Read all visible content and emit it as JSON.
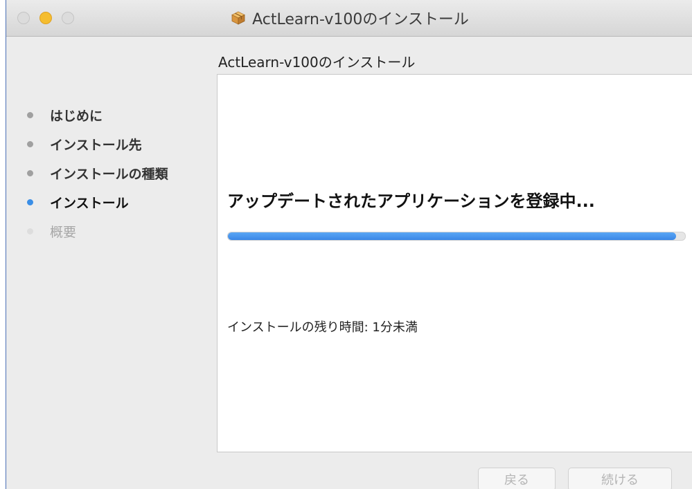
{
  "window": {
    "title": "ActLearn-v100のインストール",
    "app_icon": "package-icon"
  },
  "header": {
    "subtitle": "ActLearn-v100のインストール"
  },
  "sidebar": {
    "steps": [
      {
        "label": "はじめに",
        "state": "done"
      },
      {
        "label": "インストール先",
        "state": "done"
      },
      {
        "label": "インストールの種類",
        "state": "done"
      },
      {
        "label": "インストール",
        "state": "current"
      },
      {
        "label": "概要",
        "state": "future"
      }
    ]
  },
  "main": {
    "status": "アップデートされたアプリケーションを登録中...",
    "progress_percent": 98,
    "remaining_time": "インストールの残り時間: 1分未満"
  },
  "buttons": {
    "back_label": "戻る",
    "continue_label": "続ける"
  },
  "colors": {
    "accent": "#3a8ee6",
    "minimize": "#f5bd2f"
  }
}
